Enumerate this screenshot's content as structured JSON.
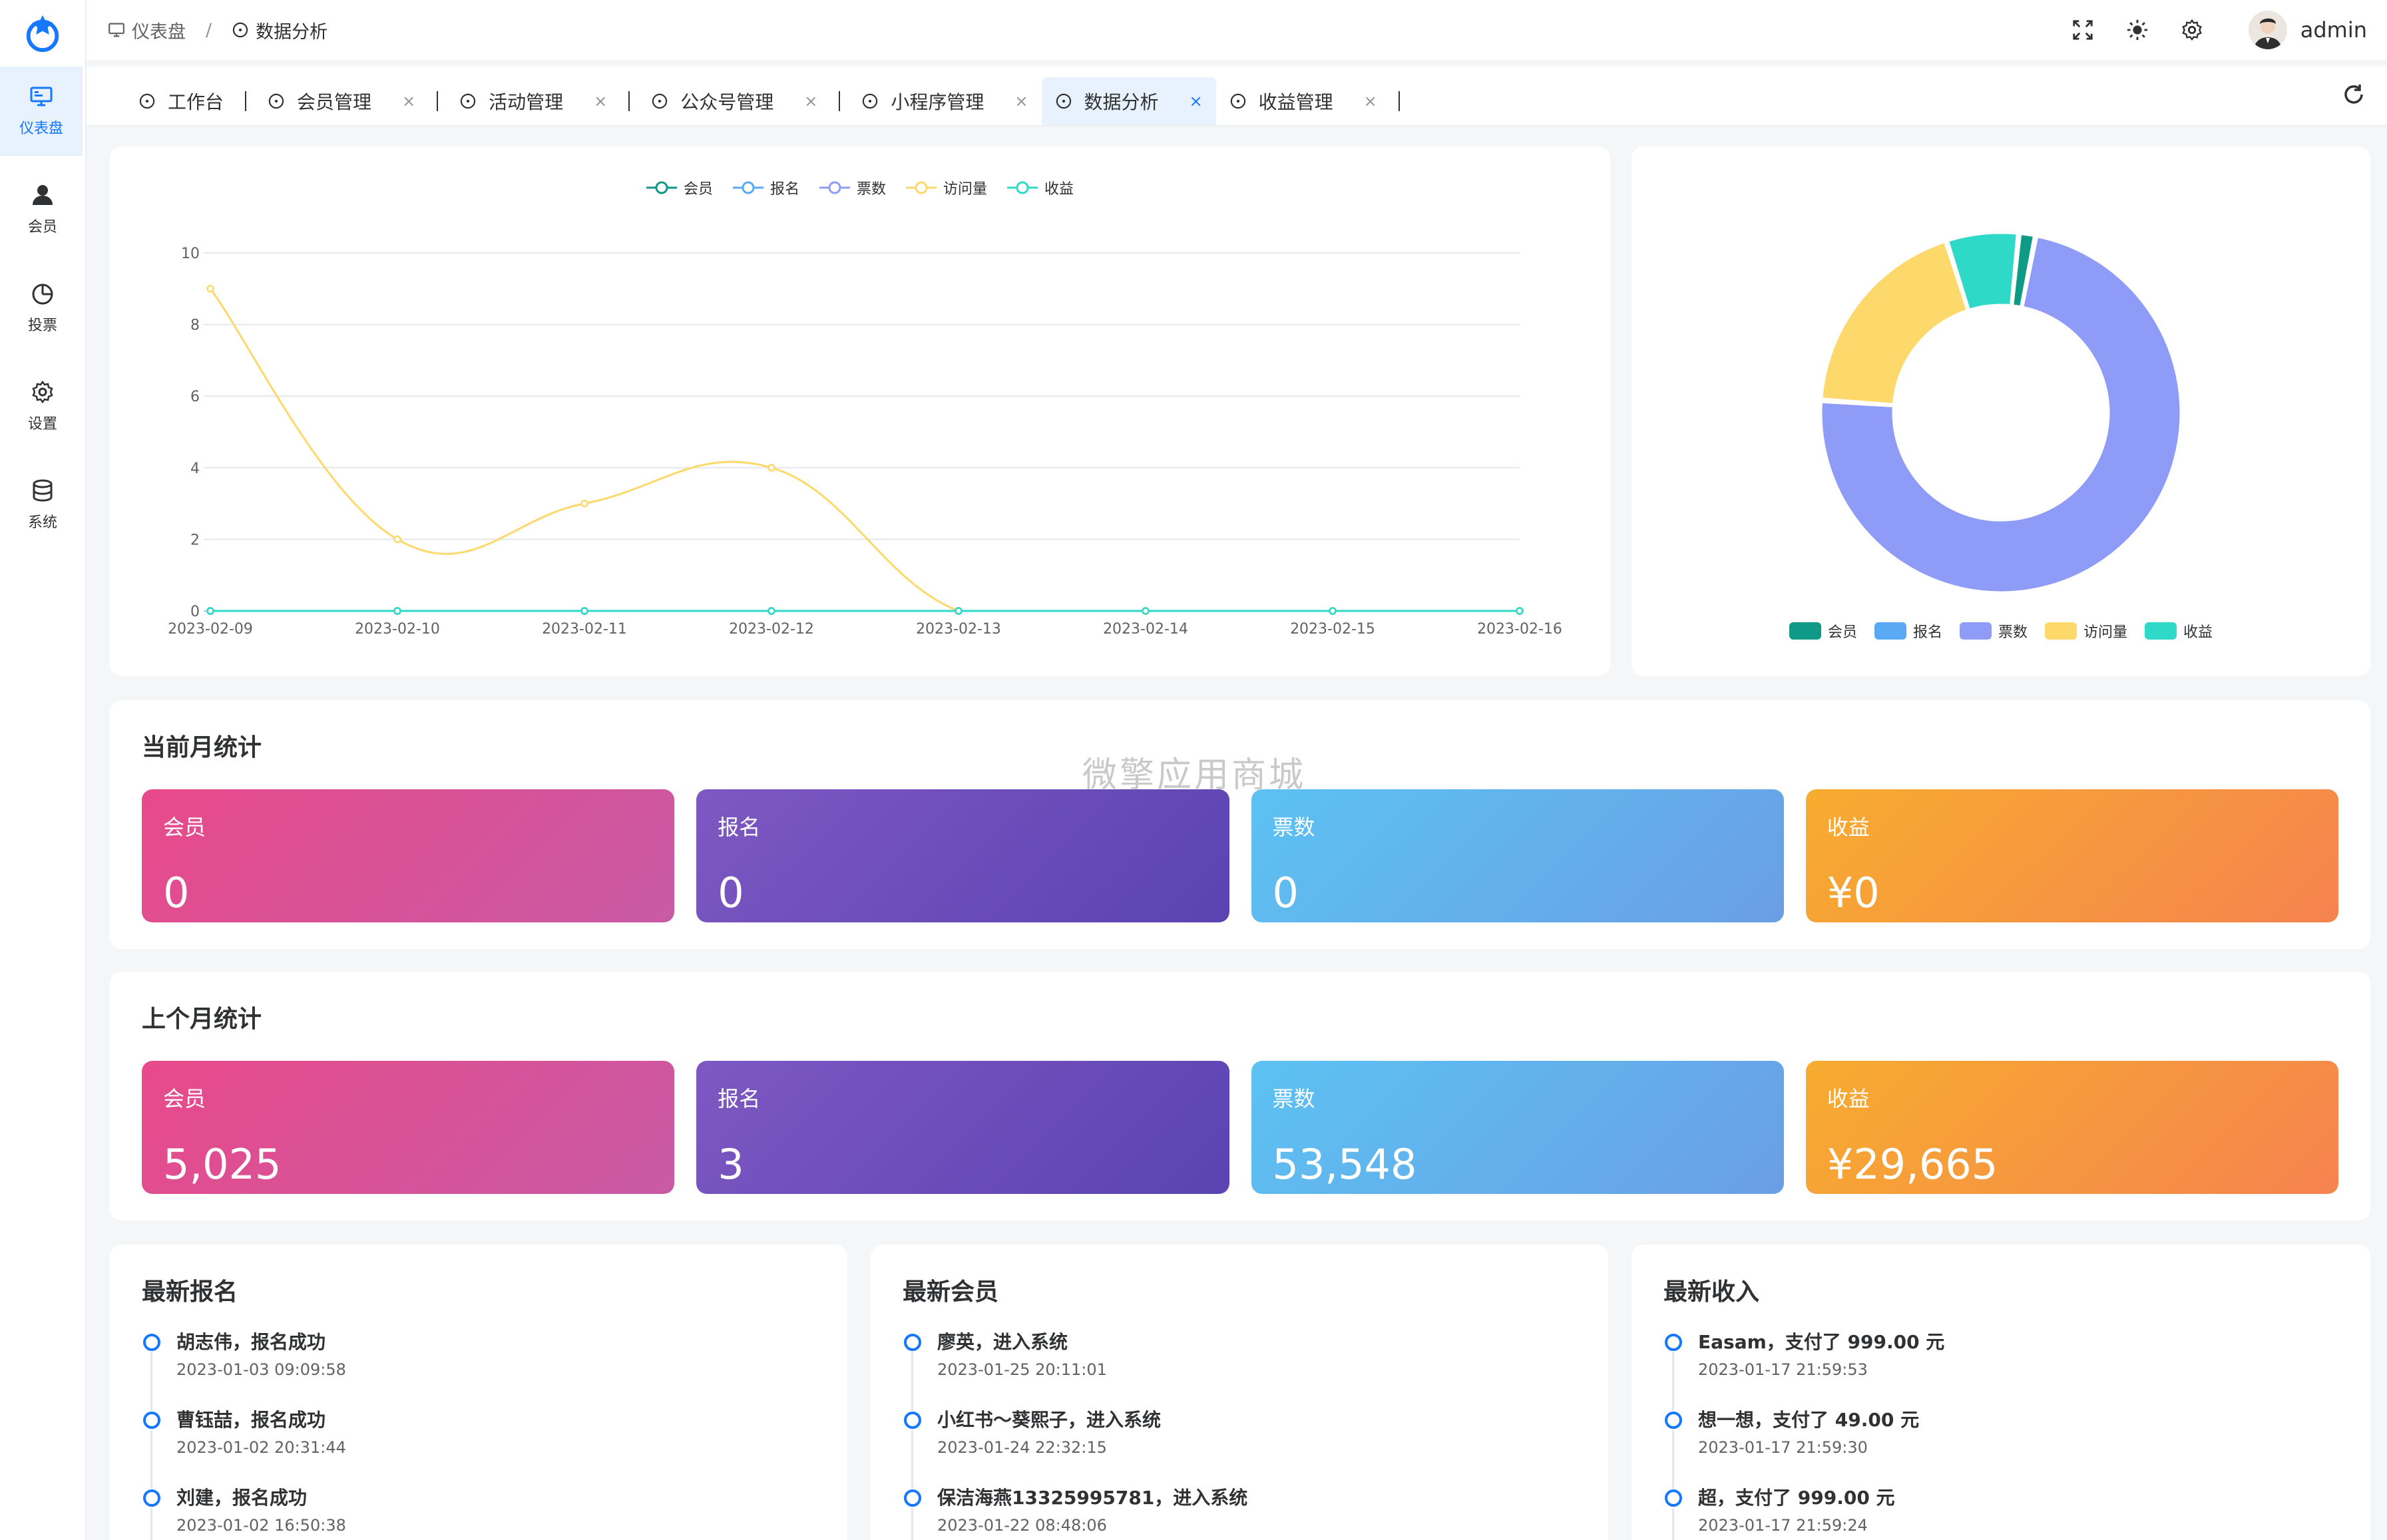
{
  "sidebar": {
    "logo": "logo-icon",
    "items": [
      {
        "label": "仪表盘",
        "icon": "monitor-icon",
        "active": true
      },
      {
        "label": "会员",
        "icon": "user-icon"
      },
      {
        "label": "投票",
        "icon": "pie-icon"
      },
      {
        "label": "设置",
        "icon": "gear-icon"
      },
      {
        "label": "系统",
        "icon": "database-icon"
      }
    ]
  },
  "header": {
    "breadcrumb": [
      "仪表盘",
      "数据分析"
    ],
    "breadcrumb_sep": "/",
    "username": "admin"
  },
  "tabs": [
    {
      "label": "工作台",
      "closable": false
    },
    {
      "label": "会员管理",
      "closable": true
    },
    {
      "label": "活动管理",
      "closable": true
    },
    {
      "label": "公众号管理",
      "closable": true
    },
    {
      "label": "小程序管理",
      "closable": true
    },
    {
      "label": "数据分析",
      "closable": true,
      "active": true
    },
    {
      "label": "收益管理",
      "closable": true
    }
  ],
  "tab_close_glyph": "×",
  "colors": {
    "member": "#0f9a87",
    "signup": "#5aa9f5",
    "votes": "#8f9cf7",
    "visits": "#fcd96a",
    "income": "#2fd9c8",
    "accent": "#1677ff"
  },
  "chart_data": [
    {
      "type": "line",
      "x": [
        "2023-02-09",
        "2023-02-10",
        "2023-02-11",
        "2023-02-12",
        "2023-02-13",
        "2023-02-14",
        "2023-02-15",
        "2023-02-16"
      ],
      "ylim": [
        0,
        10
      ],
      "yticks": [
        0,
        2,
        4,
        6,
        8,
        10
      ],
      "grid": true,
      "smooth": true,
      "legend_position": "top",
      "series": [
        {
          "name": "会员",
          "values": [
            0,
            0,
            0,
            0,
            0,
            0,
            0,
            0
          ]
        },
        {
          "name": "报名",
          "values": [
            0,
            0,
            0,
            0,
            0,
            0,
            0,
            0
          ]
        },
        {
          "name": "票数",
          "values": [
            0,
            0,
            0,
            0,
            0,
            0,
            0,
            0
          ]
        },
        {
          "name": "访问量",
          "values": [
            9,
            2,
            3,
            4,
            0,
            0,
            0,
            0
          ]
        },
        {
          "name": "收益",
          "values": [
            0,
            0,
            0,
            0,
            0,
            0,
            0,
            0
          ]
        }
      ]
    },
    {
      "type": "pie",
      "style": "donut",
      "legend_position": "bottom",
      "labels": [
        "会员",
        "报名",
        "票数",
        "访问量",
        "收益"
      ],
      "values": [
        1.5,
        0,
        73,
        19,
        6.5
      ]
    }
  ],
  "current_month": {
    "title": "当前月统计",
    "stats": [
      {
        "label": "会员",
        "value": "0"
      },
      {
        "label": "报名",
        "value": "0"
      },
      {
        "label": "票数",
        "value": "0"
      },
      {
        "label": "收益",
        "value": "¥0"
      }
    ]
  },
  "last_month": {
    "title": "上个月统计",
    "stats": [
      {
        "label": "会员",
        "value": "5,025"
      },
      {
        "label": "报名",
        "value": "3"
      },
      {
        "label": "票数",
        "value": "53,548"
      },
      {
        "label": "收益",
        "value": "¥29,665"
      }
    ]
  },
  "watermark": "微擎应用商城",
  "latest_signups": {
    "title": "最新报名",
    "items": [
      {
        "text": "胡志伟，报名成功",
        "time": "2023-01-03 09:09:58"
      },
      {
        "text": "曹钰喆，报名成功",
        "time": "2023-01-02 20:31:44"
      },
      {
        "text": "刘建，报名成功",
        "time": "2023-01-02 16:50:38"
      }
    ]
  },
  "latest_members": {
    "title": "最新会员",
    "items": [
      {
        "text": "廖英，进入系统",
        "time": "2023-01-25 20:11:01"
      },
      {
        "text": "小红书～葵熙子，进入系统",
        "time": "2023-01-24 22:32:15"
      },
      {
        "text": "保洁海燕13325995781，进入系统",
        "time": "2023-01-22 08:48:06"
      }
    ]
  },
  "latest_income": {
    "title": "最新收入",
    "items": [
      {
        "text": "Easam，支付了 999.00 元",
        "time": "2023-01-17 21:59:53"
      },
      {
        "text": "想一想，支付了 49.00 元",
        "time": "2023-01-17 21:59:30"
      },
      {
        "text": "超，支付了 999.00 元",
        "time": "2023-01-17 21:59:24"
      }
    ]
  }
}
